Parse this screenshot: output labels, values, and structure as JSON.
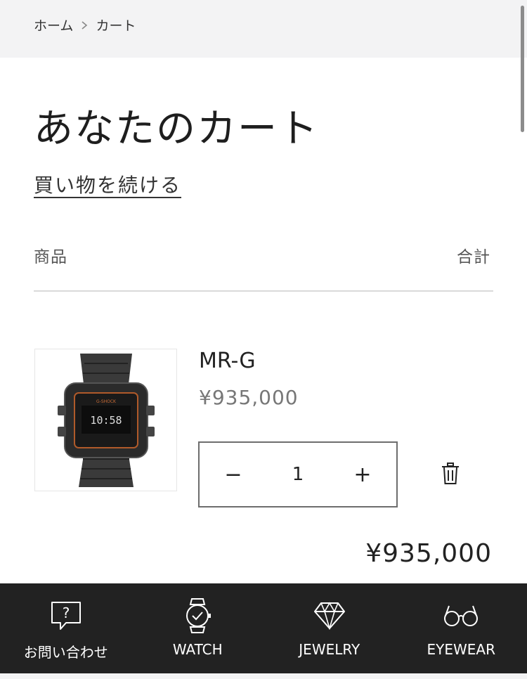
{
  "breadcrumb": {
    "home": "ホーム",
    "current": "カート"
  },
  "page": {
    "title": "あなたのカート",
    "continue_shopping": "買い物を続ける"
  },
  "table": {
    "product_header": "商品",
    "total_header": "合計"
  },
  "cart_item": {
    "name": "MR-G",
    "price": "¥935,000",
    "quantity": "1",
    "decrement_label": "−",
    "increment_label": "+",
    "line_total": "¥935,000",
    "image_icon": "watch-product-image"
  },
  "bottom_nav": [
    {
      "label": "お問い合わせ",
      "icon": "chat-question-icon"
    },
    {
      "label": "WATCH",
      "icon": "watch-icon"
    },
    {
      "label": "JEWELRY",
      "icon": "diamond-icon"
    },
    {
      "label": "EYEWEAR",
      "icon": "glasses-icon"
    }
  ],
  "colors": {
    "nav_bg": "#222222",
    "breadcrumb_bg": "#f3f3f4",
    "price_gray": "#777777"
  }
}
